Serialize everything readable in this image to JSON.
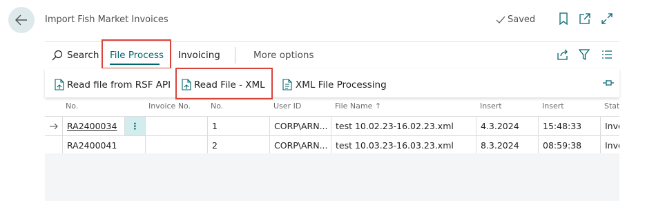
{
  "header": {
    "title": "Import Fish Market Invoices",
    "saved_label": "Saved"
  },
  "actionbar": {
    "search_label": "Search",
    "tab_file_process": "File Process",
    "tab_invoicing": "Invoicing",
    "more_options": "More options"
  },
  "ribbon": {
    "read_rsf": "Read file from RSF API",
    "read_xml": "Read File - XML",
    "xml_processing": "XML File Processing"
  },
  "table": {
    "columns": [
      "No.",
      "Invoice No.",
      "No.",
      "User ID",
      "File Name ↑",
      "Insert",
      "Insert",
      "Stat"
    ],
    "rows": [
      {
        "no": "RA2400034",
        "invoice_no": "",
        "line_no": "1",
        "user_id": "CORP\\ARN...",
        "file_name": "test 10.02.23-16.02.23.xml",
        "insert_date": "4.3.2024",
        "insert_time": "15:48:33",
        "status": "Invo"
      },
      {
        "no": "RA2400041",
        "invoice_no": "",
        "line_no": "2",
        "user_id": "CORP\\ARN...",
        "file_name": "test 10.03.23-16.03.23.xml",
        "insert_date": "8.3.2024",
        "insert_time": "08:59:38",
        "status": "Invo"
      }
    ]
  },
  "colors": {
    "accent": "#00656e",
    "highlight": "#d9433a"
  }
}
